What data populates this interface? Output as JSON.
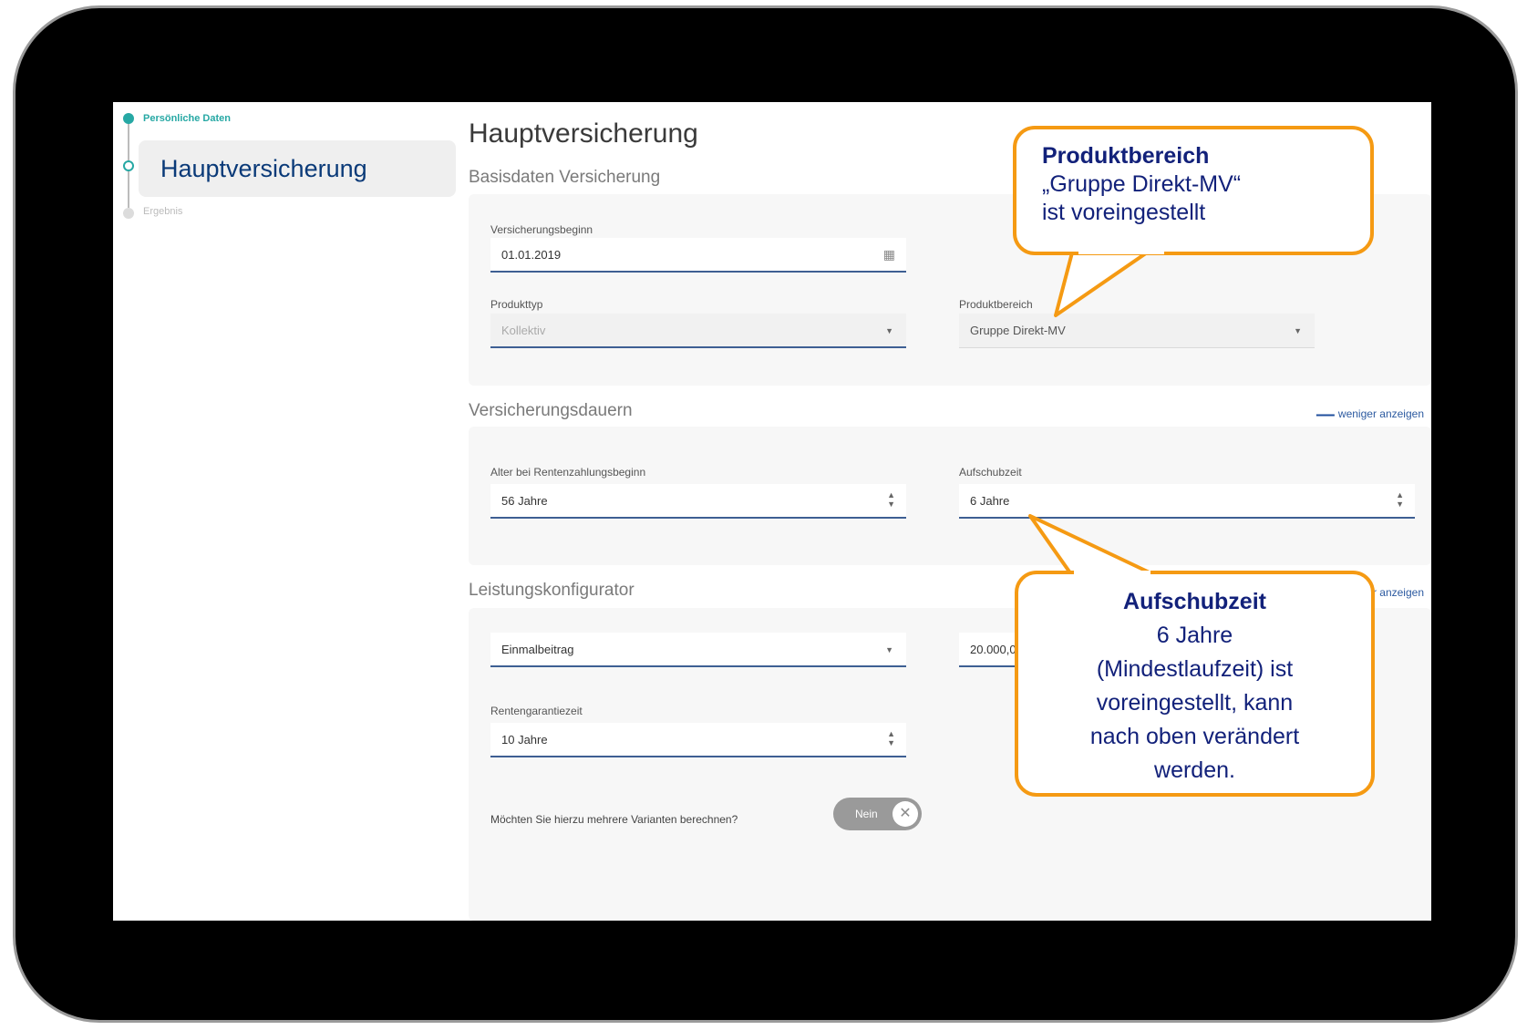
{
  "stepper": {
    "steps": [
      {
        "label": "Persönliche Daten",
        "state": "done"
      },
      {
        "label": "Hauptversicherung",
        "state": "active"
      },
      {
        "label": "Ergebnis",
        "state": "pending"
      }
    ]
  },
  "page_title": "Hauptversicherung",
  "basisdaten": {
    "title": "Basisdaten Versicherung",
    "beginn_label": "Versicherungsbeginn",
    "beginn_value": "01.01.2019",
    "produkttyp_label": "Produkttyp",
    "produkttyp_value": "Kollektiv",
    "produktbereich_label": "Produktbereich",
    "produktbereich_value": "Gruppe Direkt-MV"
  },
  "dauern": {
    "title": "Versicherungsdauern",
    "toggle": "weniger anzeigen",
    "alter_label": "Alter bei Rentenzahlungsbeginn",
    "alter_value": "56 Jahre",
    "aufschub_label": "Aufschubzeit",
    "aufschub_value": "6 Jahre"
  },
  "leistung": {
    "title": "Leistungskonfigurator",
    "toggle": "mehr anzeigen",
    "beitragsart_value": "Einmalbeitrag",
    "betrag_value": "20.000,00 €",
    "garantie_label": "Rentengarantiezeit",
    "garantie_value": "10 Jahre",
    "varianten_question": "Möchten Sie hierzu mehrere Varianten berechnen?",
    "varianten_switch": "Nein"
  },
  "callouts": {
    "produktbereich": {
      "head": "Produktbereich",
      "line1": "„Gruppe Direkt-MV“",
      "line2": "ist voreingestellt"
    },
    "aufschubzeit": {
      "head": "Aufschubzeit",
      "line1": "6 Jahre",
      "line2": "(Mindestlaufzeit) ist",
      "line3": "voreingestellt, kann",
      "line4": "nach oben verändert",
      "line5": "werden."
    }
  },
  "colors": {
    "accent_teal": "#26a8a4",
    "nav_blue": "#0a3a78",
    "callout_orange": "#f59a13",
    "callout_text": "#12217a"
  }
}
